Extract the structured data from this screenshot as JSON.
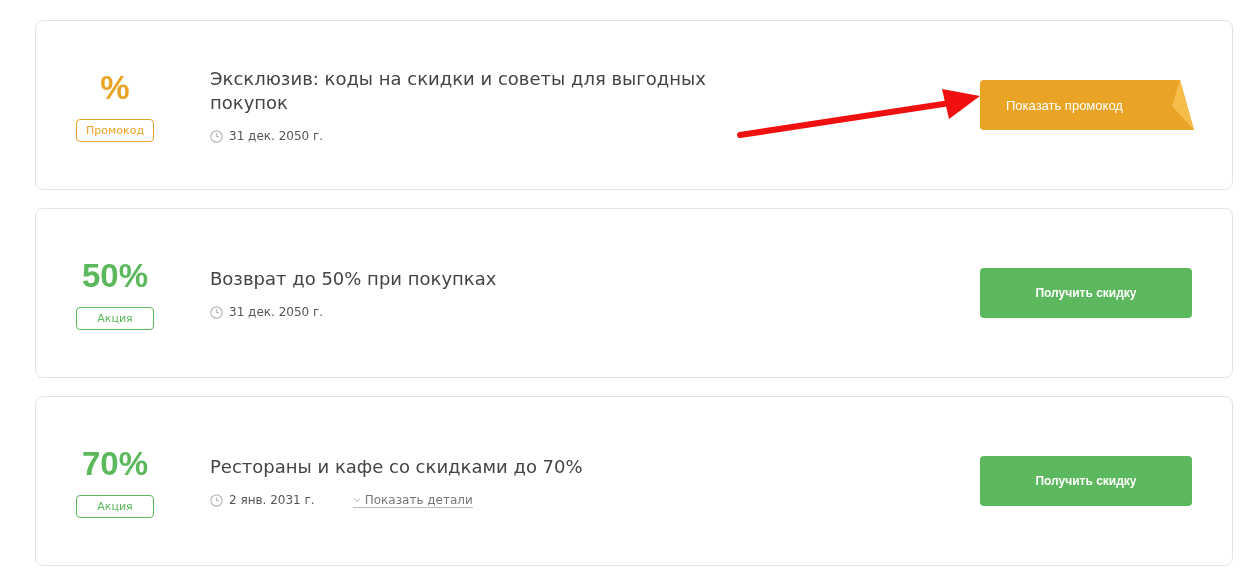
{
  "offers": [
    {
      "kind": "promo",
      "value": "%",
      "badge": "Промокод",
      "title": "Эксклюзив: коды на скидки и советы для выгодных покупок",
      "date": "31 дек. 2050 г.",
      "button": "Показать промокод"
    },
    {
      "kind": "sale",
      "value": "50%",
      "badge": "Акция",
      "title": "Возврат до 50% при покупках",
      "date": "31 дек. 2050 г.",
      "button": "Получить скидку"
    },
    {
      "kind": "sale",
      "value": "70%",
      "badge": "Акция",
      "title": "Рестораны и кафе со скидками до 70%",
      "date": "2 янв. 2031 г.",
      "details_link": "Показать детали",
      "button": "Получить скидку"
    }
  ]
}
